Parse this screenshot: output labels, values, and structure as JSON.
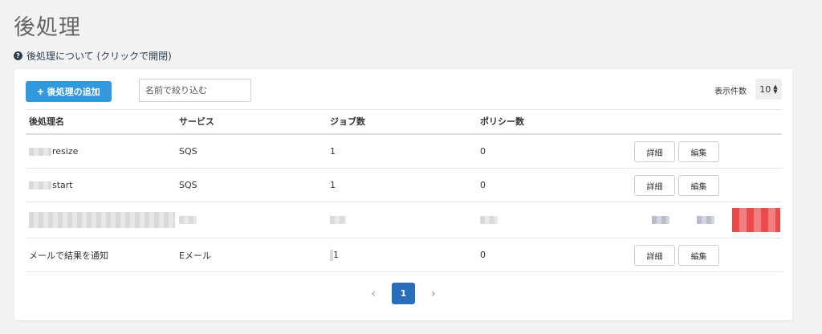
{
  "page": {
    "title": "後処理"
  },
  "help": {
    "text": "後処理について (クリックで開閉)",
    "icon": "question-circle-icon"
  },
  "toolbar": {
    "add_label": "後処理の追加",
    "search_placeholder": "名前で絞り込む",
    "per_page_label": "表示件数",
    "per_page_value": "10"
  },
  "table": {
    "headers": [
      "後処理名",
      "サービス",
      "ジョブ数",
      "ポリシー数"
    ],
    "rows": [
      {
        "name": "resize",
        "service": "SQS",
        "jobs": "1",
        "policies": "0",
        "detail": "詳細",
        "edit": "編集"
      },
      {
        "name": "start",
        "service": "SQS",
        "jobs": "1",
        "policies": "0",
        "detail": "詳細",
        "edit": "編集"
      },
      {
        "name": "",
        "service": "",
        "jobs": "",
        "policies": ""
      },
      {
        "name": "メールで結果を通知",
        "service": "Eメール",
        "jobs": "1",
        "policies": "0",
        "detail": "詳細",
        "edit": "編集"
      }
    ]
  },
  "pagination": {
    "prev": "‹",
    "current": "1",
    "next": "›"
  },
  "colors": {
    "primary": "#3399dd",
    "active_page": "#2a6ebb"
  }
}
